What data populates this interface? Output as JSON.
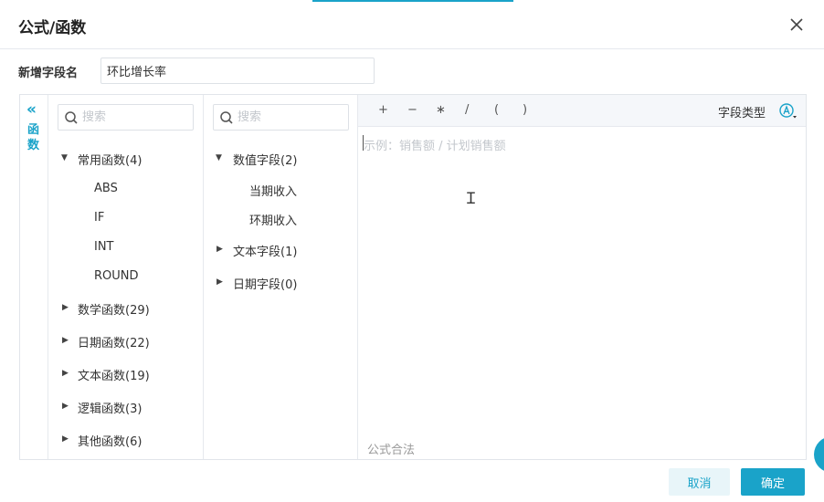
{
  "dialog": {
    "title": "公式/函数",
    "close_icon": "close-icon",
    "accent_color": "#1aa3c9"
  },
  "field_name": {
    "label": "新增字段名",
    "value": "环比增长率"
  },
  "side_tab": {
    "collapse_icon": "double-chevron-left-icon",
    "label": "函数"
  },
  "functions": {
    "search_placeholder": "搜索",
    "groups": [
      {
        "label": "常用函数(4)",
        "expanded": true,
        "items": [
          "ABS",
          "IF",
          "INT",
          "ROUND"
        ]
      },
      {
        "label": "数学函数(29)",
        "expanded": false
      },
      {
        "label": "日期函数(22)",
        "expanded": false
      },
      {
        "label": "文本函数(19)",
        "expanded": false
      },
      {
        "label": "逻辑函数(3)",
        "expanded": false
      },
      {
        "label": "其他函数(6)",
        "expanded": false
      }
    ]
  },
  "fields": {
    "search_placeholder": "搜索",
    "groups": [
      {
        "label": "数值字段(2)",
        "expanded": true,
        "items": [
          "当期收入",
          "环期收入"
        ]
      },
      {
        "label": "文本字段(1)",
        "expanded": false
      },
      {
        "label": "日期字段(0)",
        "expanded": false
      }
    ]
  },
  "editor": {
    "operators": [
      "+",
      "−",
      "∗",
      "/",
      "(",
      ")"
    ],
    "field_type_label": "字段类型",
    "field_type_icon": "circled-a-icon",
    "placeholder": "示例：销售额 / 计划销售额",
    "status": "公式合法"
  },
  "footer": {
    "cancel_label": "取消",
    "ok_label": "确定"
  }
}
